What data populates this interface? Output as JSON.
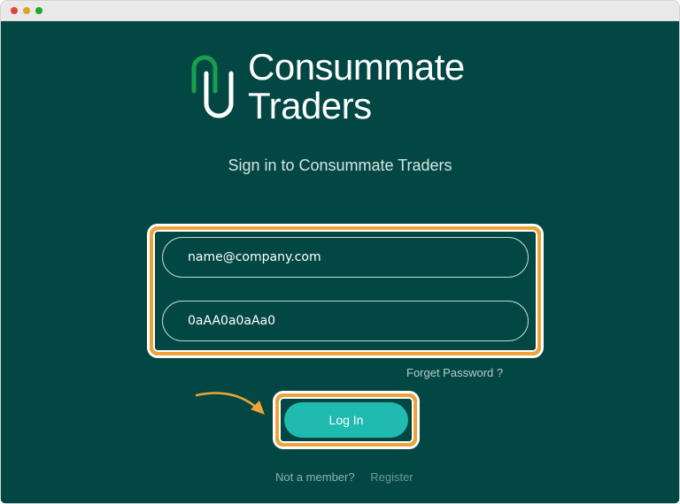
{
  "brand": {
    "line1": "Consummate",
    "line2": "Traders",
    "accent_color": "#1a9e4b"
  },
  "signin": {
    "title": "Sign in to Consummate Traders"
  },
  "form": {
    "email_value": "name@company.com",
    "password_value": "0aAA0a0aAa0",
    "forget_label": "Forget Password ?",
    "login_label": "Log In"
  },
  "footer": {
    "question": "Not a member?",
    "register_label": "Register"
  },
  "colors": {
    "background": "#024744",
    "button": "#1fbab0",
    "highlight": "#f0a33a"
  }
}
